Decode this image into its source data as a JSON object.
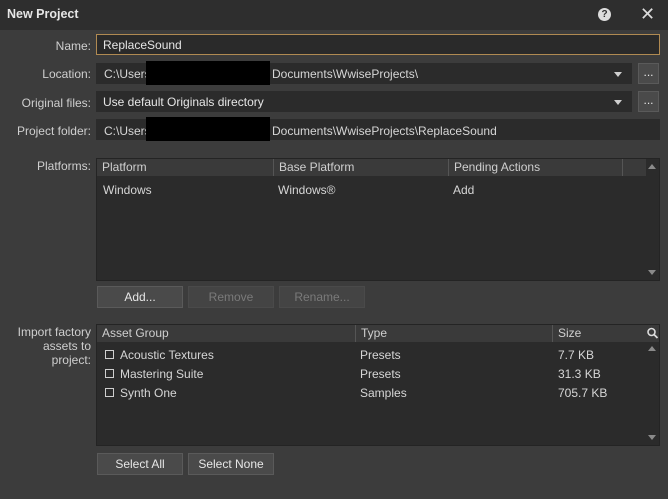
{
  "window": {
    "title": "New Project"
  },
  "form": {
    "name_label": "Name:",
    "name_value": "ReplaceSound",
    "location_label": "Location:",
    "location_prefix": "C:\\Users",
    "location_suffix": "Documents\\WwiseProjects\\",
    "original_files_label": "Original files:",
    "original_files_value": "Use default Originals directory",
    "project_folder_label": "Project folder:",
    "project_folder_prefix": "C:\\Users",
    "project_folder_suffix": "Documents\\WwiseProjects\\ReplaceSound",
    "browse_label": "..."
  },
  "platforms": {
    "label": "Platforms:",
    "columns": [
      "Platform",
      "Base Platform",
      "Pending Actions"
    ],
    "rows": [
      {
        "platform": "Windows",
        "base_platform": "Windows®",
        "pending_actions": "Add"
      }
    ],
    "add_button": "Add...",
    "remove_button": "Remove",
    "rename_button": "Rename..."
  },
  "factory_assets": {
    "label_lines": [
      "Import factory",
      "assets to",
      "project:"
    ],
    "columns": [
      "Asset Group",
      "Type",
      "Size"
    ],
    "rows": [
      {
        "name": "Acoustic Textures",
        "type": "Presets",
        "size": "7.7 KB",
        "checked": false
      },
      {
        "name": "Mastering Suite",
        "type": "Presets",
        "size": "31.3 KB",
        "checked": false
      },
      {
        "name": "Synth One",
        "type": "Samples",
        "size": "705.7 KB",
        "checked": false
      }
    ],
    "select_all_button": "Select All",
    "select_none_button": "Select None"
  }
}
